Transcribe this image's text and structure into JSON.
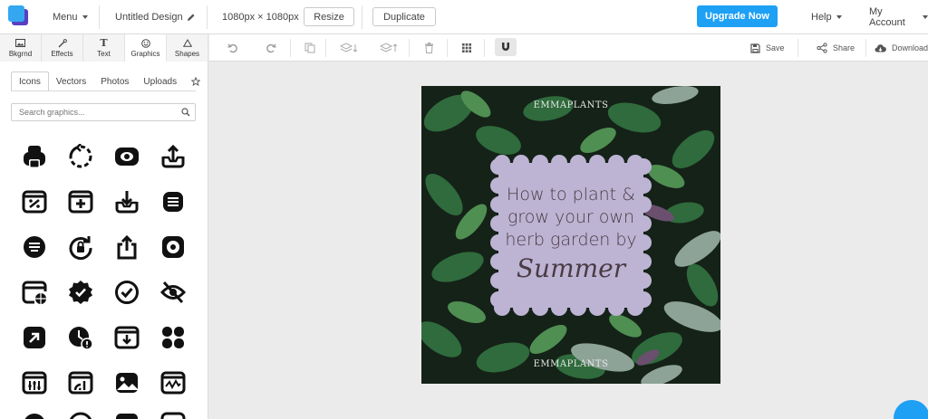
{
  "topbar": {
    "menu_label": "Menu",
    "design_title": "Untitled Design",
    "size": "1080px × 1080px",
    "resize_label": "Resize",
    "duplicate_label": "Duplicate",
    "upgrade_label": "Upgrade Now",
    "help_label": "Help",
    "account_label": "My Account"
  },
  "sidebar": {
    "tabs": [
      {
        "label": "Bkgrnd",
        "icon": "background-icon"
      },
      {
        "label": "Effects",
        "icon": "wand-icon"
      },
      {
        "label": "Text",
        "icon": "text-icon"
      },
      {
        "label": "Graphics",
        "icon": "smiley-icon"
      },
      {
        "label": "Shapes",
        "icon": "triangle-icon"
      }
    ],
    "sub_tabs": [
      "Icons",
      "Vectors",
      "Photos",
      "Uploads"
    ],
    "search_placeholder": "Search graphics...",
    "icons": [
      "printer-icon",
      "refresh-dashed-icon",
      "eye-box-icon",
      "upload-tray-icon",
      "percent-box-icon",
      "add-box-icon",
      "download-tray-icon",
      "menu-circle-icon",
      "menu-round-icon",
      "rotate-lock-icon",
      "share-up-icon",
      "cd-box-icon",
      "browser-globe-icon",
      "badge-check-icon",
      "check-circle-icon",
      "eye-off-icon",
      "arrow-up-right-icon",
      "clock-alert-icon",
      "download-box-icon",
      "grid-blobs-icon",
      "equalizer-icon",
      "signal-box-icon",
      "image-icon",
      "waveform-icon"
    ]
  },
  "toolbar2": {
    "save_label": "Save",
    "share_label": "Share",
    "download_label": "Download"
  },
  "canvas": {
    "brand_top": "EMMAPLANTS",
    "brand_bottom": "EMMAPLANTS",
    "headline_1": "How to plant &",
    "headline_2": "grow your own",
    "headline_3": "herb garden by",
    "script_word": "Summer",
    "card_color": "#bdb4d4"
  },
  "colors": {
    "accent": "#1ea0f5",
    "logo_front": "#35a7f0",
    "logo_back": "#5a3fc0"
  }
}
